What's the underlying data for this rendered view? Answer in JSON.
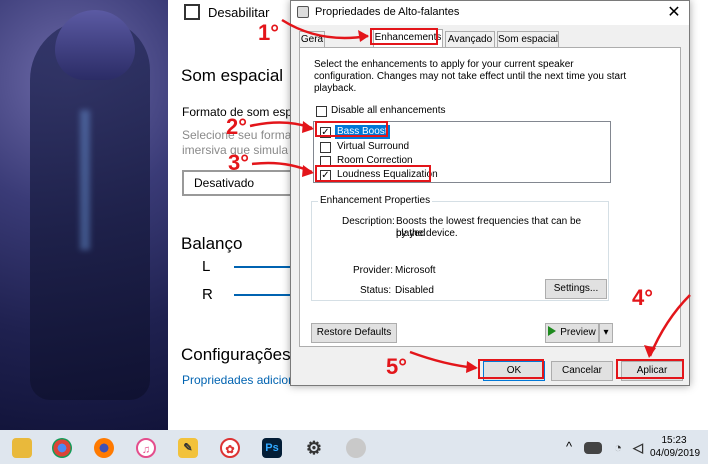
{
  "settings": {
    "disable_label": "Desabilitar",
    "spatial_heading": "Som espacial",
    "format_label": "Formato de som esp",
    "desc_line1": "Selecione seu formai",
    "desc_line2": "imersiva que simula",
    "dropdown_value": "Desativado",
    "balance_heading": "Balanço",
    "left_channel": "L",
    "right_channel": "R",
    "configs_heading": "Configurações",
    "link": "Propriedades adicior"
  },
  "dialog": {
    "title": "Propriedades de Alto-falantes",
    "close_glyph": "✕",
    "tabs": [
      {
        "label": "Gera"
      },
      {
        "label": "Enhancements"
      },
      {
        "label": "Avançado"
      },
      {
        "label": "Som espacial"
      }
    ],
    "intro_line1": "Select the enhancements to apply for your current speaker",
    "intro_line2": "configuration. Changes may not take effect until the next time you start",
    "intro_line3": "playback.",
    "disable_all": "Disable all enhancements",
    "enhancements": [
      {
        "label": "Bass Boost",
        "checked": true,
        "selected": true
      },
      {
        "label": "Virtual Surround",
        "checked": false,
        "selected": false
      },
      {
        "label": "Room Correction",
        "checked": false,
        "selected": false
      },
      {
        "label": "Loudness Equalization",
        "checked": true,
        "selected": false
      }
    ],
    "props_group": "Enhancement Properties",
    "description_label": "Description:",
    "description_line1": "Boosts the lowest frequencies that can be played",
    "description_line2": "by the device.",
    "provider_label": "Provider:",
    "provider_value": "Microsoft",
    "status_label": "Status:",
    "status_value": "Disabled",
    "settings_button": "Settings...",
    "restore_button": "Restore Defaults",
    "preview_button": "Preview",
    "preview_arrow": "▾",
    "ok_button": "OK",
    "cancel_button": "Cancelar",
    "apply_button": "Aplicar"
  },
  "annotations": {
    "step1": "1°",
    "step2": "2°",
    "step3": "3°",
    "step4": "4°",
    "step5": "5°",
    "color": "#e3151a"
  },
  "taskbar": {
    "time": "15:23",
    "date": "04/09/2019",
    "apps": [
      "folder-icon",
      "chrome-icon",
      "firefox-icon",
      "itunes-icon",
      "tools-icon",
      "paint-icon",
      "photoshop-icon",
      "gear-icon",
      "speaker-icon"
    ],
    "ps_label": "Ps",
    "chevron": "^"
  }
}
